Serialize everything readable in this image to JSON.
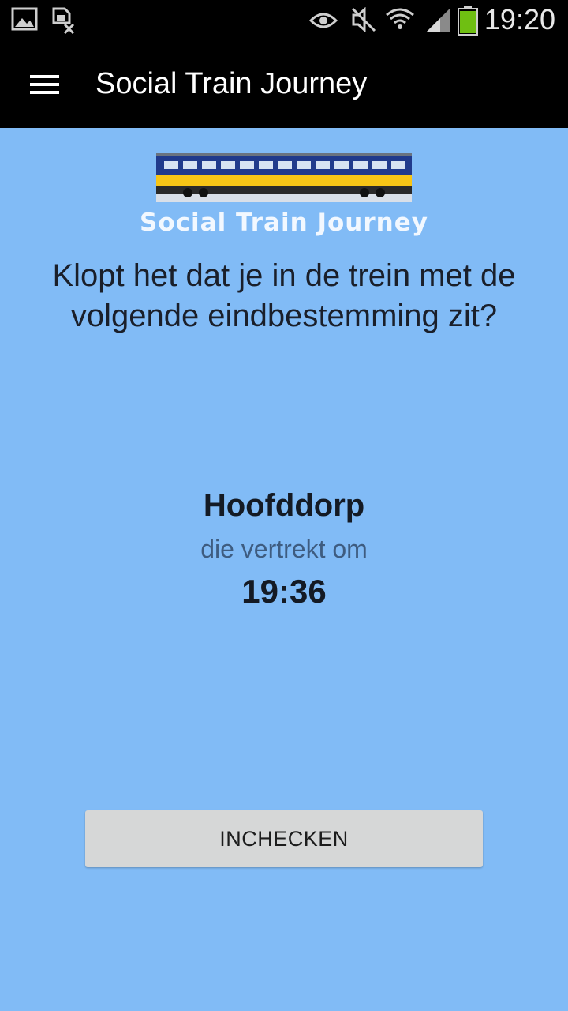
{
  "status_bar": {
    "time": "19:20",
    "icons": [
      "gallery-icon",
      "sim-off-icon",
      "eye-icon",
      "mute-icon",
      "wifi-icon",
      "signal-icon",
      "battery-icon"
    ]
  },
  "app_bar": {
    "title": "Social Train Journey",
    "menu_icon": "hamburger-menu-icon"
  },
  "logo": {
    "caption": "Social Train Journey"
  },
  "question": "Klopt het dat je in de trein met de volgende eindbestemming zit?",
  "trip": {
    "destination": "Hoofddorp",
    "departs_label": "die vertrekt om",
    "departure_time": "19:36"
  },
  "checkin_button": {
    "label": "INCHECKEN"
  },
  "colors": {
    "background": "#81bbf6",
    "app_bar": "#000000",
    "button": "#d6d7d7",
    "train_yellow": "#f7c516",
    "train_blue": "#203a8c"
  }
}
